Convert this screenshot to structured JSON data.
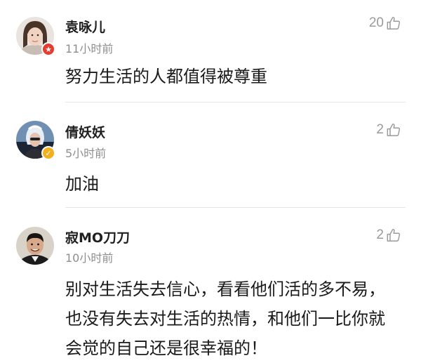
{
  "comments": [
    {
      "username": "袁咏儿",
      "timestamp": "11小时前",
      "likes": "20",
      "text": "努力生活的人都值得被尊重",
      "badge": "red-star",
      "badge_color": "#e63b2e"
    },
    {
      "username": "倩妖妖",
      "timestamp": "5小时前",
      "likes": "2",
      "text": "加油",
      "badge": "gold-check",
      "badge_color": "#f2b01e"
    },
    {
      "username": "寂MO刀刀",
      "timestamp": "10小时前",
      "likes": "2",
      "text": "别对生活失去信心，看看他们活的多不易，也没有失去对生活的热情，和他们一比你就会觉的自己还是很幸福的！",
      "badge": null
    }
  ],
  "icons": {
    "like": "thumbs-up-icon",
    "verified_red": "star-badge-icon",
    "verified_gold": "check-badge-icon"
  }
}
